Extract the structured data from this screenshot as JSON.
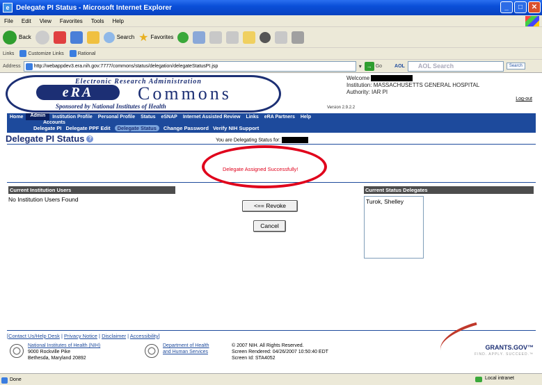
{
  "window": {
    "title": "Delegate PI Status - Microsoft Internet Explorer"
  },
  "menu": [
    "File",
    "Edit",
    "View",
    "Favorites",
    "Tools",
    "Help"
  ],
  "toolbar": {
    "back": "Back",
    "search": "Search",
    "favorites": "Favorites"
  },
  "links_bar": {
    "label": "Links",
    "items": [
      "Customize Links",
      "Rational"
    ]
  },
  "address": {
    "label": "Address",
    "url": "http://webappdev3.era.nih.gov:7777/commons/status/delegation/delegateStatusPI.jsp",
    "go": "Go",
    "aol": "AOL",
    "aol_search": "AOL Search",
    "search_btn": "Search"
  },
  "header": {
    "era_title": "Electronic Research Administration",
    "logo": "eRA",
    "commons": "Commons",
    "sponsor": "Sponsored by National Institutes of Health",
    "version": "Version 2.9.2.2",
    "welcome_label": "Welcome",
    "institution": "Institution: MASSACHUSETTS GENERAL HOSPITAL",
    "authority": "Authority:   IAR  PI",
    "logout": "Log-out"
  },
  "nav": {
    "items": [
      "Home",
      "Admin",
      "Institution Profile",
      "Personal Profile",
      "Status",
      "eSNAP",
      "Internet Assisted Review",
      "Links",
      "eRA Partners",
      "Help"
    ],
    "accounts": "Accounts",
    "sub": [
      "Delegate PI",
      "Delegate PPF Edit",
      "Delegate Status",
      "Change Password",
      "Verify NIH Support"
    ]
  },
  "page": {
    "title": "Delegate PI Status",
    "delegating_text": "You are Delegating Status for:",
    "success": "Delegate Assigned Successfully!",
    "left_header": "Current Institution Users",
    "left_empty": "No Institution Users Found",
    "right_header": "Current Status Delegates",
    "delegates": [
      "Turok, Shelley"
    ],
    "revoke": "<== Revoke",
    "cancel": "Cancel"
  },
  "footer": {
    "links": [
      "Contact Us/Help Desk",
      "Privacy Notice",
      "Disclaimer",
      "Accessibility"
    ],
    "nih_name": "National Institutes of Health (NIH)",
    "nih_addr1": "9000 Rockville Pike",
    "nih_addr2": "Bethesda, Maryland 20892",
    "hhs_1": "Department of Health",
    "hhs_2": "and Human Services",
    "copyright": "© 2007 NIH. All Rights Reserved.",
    "rendered": "Screen Rendered: 04/26/2007 10:50:40 EDT",
    "screen_id": "Screen Id: STA4052",
    "grants": "GRANTS.GOV™",
    "grants_tag": "FIND. APPLY. SUCCEED.™"
  },
  "status": {
    "left": "Done",
    "zone": "Local intranet"
  }
}
